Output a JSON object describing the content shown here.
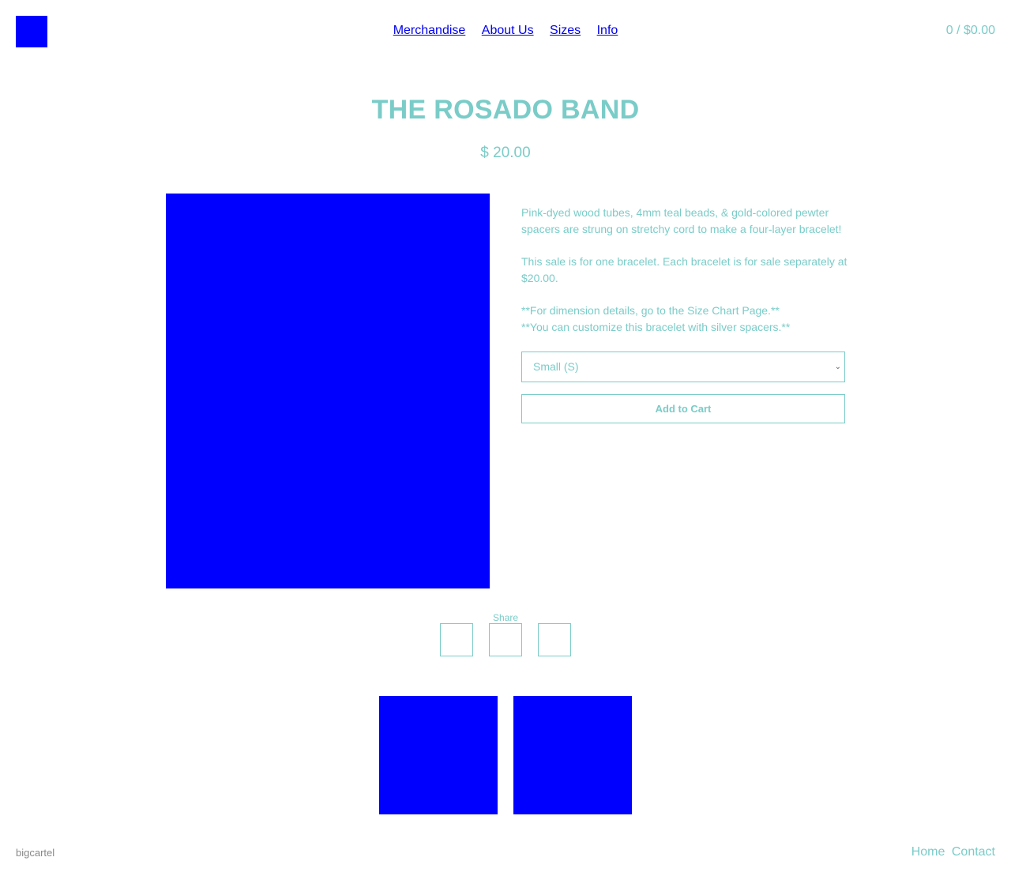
{
  "header": {
    "nav": [
      "Merchandise",
      "About Us",
      "Sizes",
      "Info"
    ],
    "cart": "0 / $0.00"
  },
  "product": {
    "title": "THE ROSADO BAND",
    "price": "$ 20.00",
    "description": [
      "Pink-dyed wood tubes, 4mm teal beads, & gold-colored pewter spacers are strung on stretchy cord to make a four-layer bracelet!",
      "This sale is for one bracelet. Each bracelet is for sale separately at $20.00.",
      "**For dimension details, go to the Size Chart Page.**",
      "**You can customize this bracelet with silver spacers.**"
    ],
    "size_selected": "Small (S)",
    "add_to_cart": "Add to Cart"
  },
  "share": {
    "label": "Share"
  },
  "footer": {
    "brand": "bigcartel",
    "links": [
      "Home",
      "Contact"
    ]
  },
  "colors": {
    "accent": "#7accc8",
    "placeholder": "#0000ff",
    "link": "#0000ee"
  }
}
